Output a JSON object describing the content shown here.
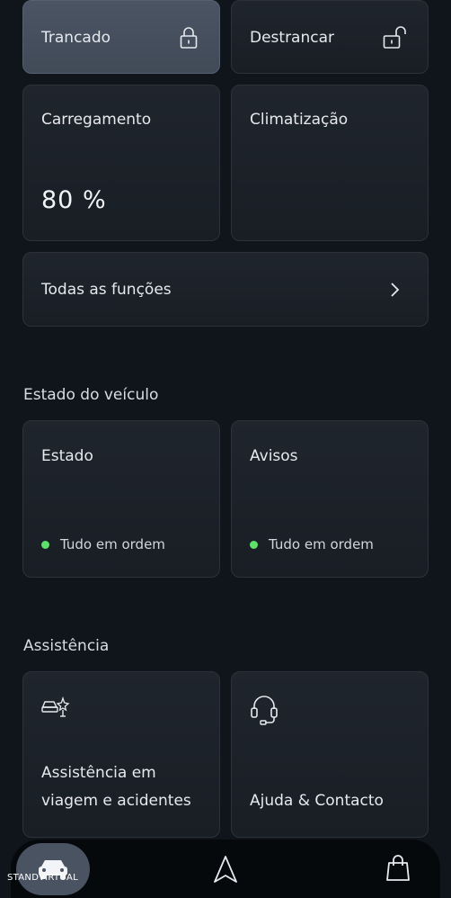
{
  "controls": {
    "lock": {
      "label": "Trancado",
      "icon": "lock-closed-icon"
    },
    "unlock": {
      "label": "Destrancar",
      "icon": "lock-open-icon"
    }
  },
  "charging": {
    "label": "Carregamento",
    "value": "80 %"
  },
  "climate": {
    "label": "Climatização"
  },
  "all_functions": {
    "label": "Todas as funções",
    "icon": "chevron-right-icon"
  },
  "vehicle_state": {
    "title": "Estado do veículo",
    "state": {
      "label": "Estado",
      "status": "Tudo em ordem"
    },
    "warnings": {
      "label": "Avisos",
      "status": "Tudo em ordem"
    },
    "status_color": "#5ee06a"
  },
  "assistance": {
    "title": "Assistência",
    "roadside": {
      "line1": "Assistência em",
      "line2": "viagem e acidentes",
      "icon": "car-crash-icon"
    },
    "help": {
      "label": "Ajuda & Contacto",
      "icon": "headset-icon"
    }
  },
  "nav": {
    "items": [
      {
        "name": "car",
        "icon": "car-icon"
      },
      {
        "name": "navigation",
        "icon": "navigation-arrow-icon"
      },
      {
        "name": "shop",
        "icon": "shopping-bag-icon"
      }
    ]
  },
  "watermark": "STANDVIRTUAL"
}
